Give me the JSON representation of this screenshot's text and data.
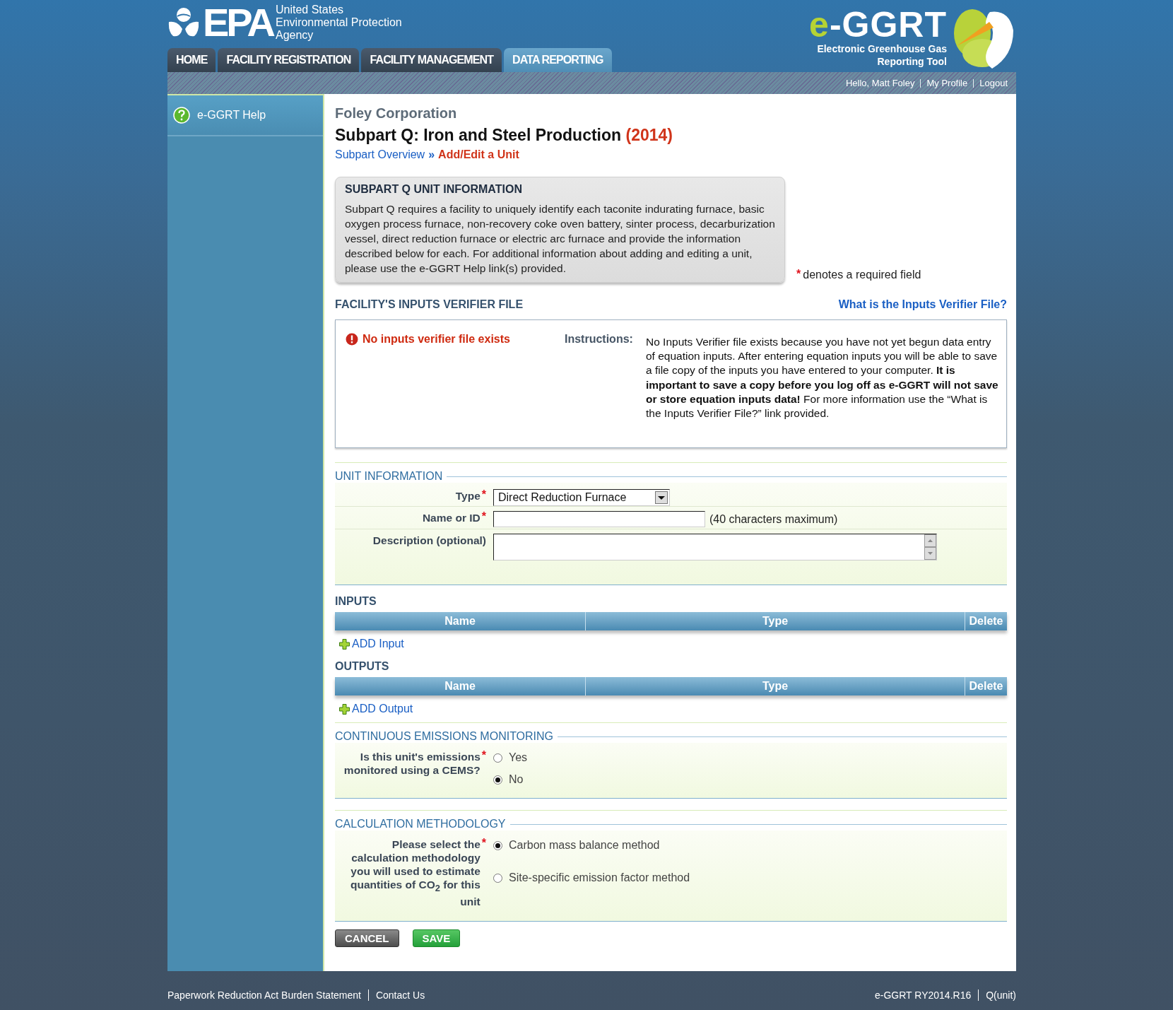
{
  "agency_logo": {
    "mark": "EPA",
    "lines": [
      "United States",
      "Environmental Protection",
      "Agency"
    ]
  },
  "tool_logo": {
    "mark_prefix": "e",
    "mark_rest": "-GGRT",
    "lines": [
      "Electronic Greenhouse Gas",
      "Reporting Tool"
    ]
  },
  "tabs": [
    {
      "label": "HOME",
      "selected": false
    },
    {
      "label": "FACILITY REGISTRATION",
      "selected": false
    },
    {
      "label": "FACILITY MANAGEMENT",
      "selected": false
    },
    {
      "label": "DATA REPORTING",
      "selected": true
    }
  ],
  "user_bar": {
    "greeting": "Hello, Matt Foley",
    "links": [
      "My Profile",
      "Logout"
    ]
  },
  "sidebar": {
    "items": [
      {
        "label": "e-GGRT Help"
      }
    ]
  },
  "required_mark": "*",
  "page": {
    "facility": "Foley Corporation",
    "title": "Subpart Q: Iron and Steel Production",
    "year": "(2014)",
    "breadcrumb_separator": "»",
    "breadcrumb": [
      {
        "label": "Subpart Overview",
        "current": false
      },
      {
        "label": "Add/Edit a Unit",
        "current": true
      }
    ]
  },
  "info_box": {
    "heading": "SUBPART Q UNIT INFORMATION",
    "text": "Subpart Q requires a facility to uniquely identify each taconite indurating furnace, basic oxygen process furnace, non-recovery coke oven battery, sinter process, decarburization vessel, direct reduction furnace or electric arc furnace and provide the information described below for each. For additional information about adding and editing a unit, please use the e-GGRT Help link(s) provided."
  },
  "required_note": "denotes a required field",
  "verifier": {
    "heading": "FACILITY'S INPUTS VERIFIER FILE",
    "help_link": "What is the Inputs Verifier File?",
    "status": "No inputs verifier file exists",
    "instructions_label": "Instructions:",
    "instructions": "No Inputs Verifier file exists because you have not yet begun data entry of equation inputs.  After entering equation inputs you will be able to save a file copy of the inputs you have entered to your computer.  **It is important to save a copy before you log off as e-GGRT will not save or store equation inputs data!** For more information use the “What is the Inputs Verifier File?” link provided."
  },
  "unit_information": {
    "legend": "UNIT INFORMATION",
    "fields": [
      {
        "kind": "select",
        "label": "Type",
        "required": true,
        "value": "Direct Reduction Furnace"
      },
      {
        "kind": "text",
        "label": "Name or ID",
        "required": true,
        "hint": "(40 characters maximum)"
      },
      {
        "kind": "textarea",
        "label": "Description (optional)",
        "required": false
      }
    ]
  },
  "inputs": {
    "heading": "INPUTS",
    "columns": [
      "Name",
      "Type",
      "Delete"
    ],
    "add_link": "ADD Input"
  },
  "outputs": {
    "heading": "OUTPUTS",
    "columns": [
      "Name",
      "Type",
      "Delete"
    ],
    "add_link": "ADD Output"
  },
  "cems": {
    "legend": "CONTINUOUS EMISSIONS MONITORING",
    "question": "Is this unit's emissions monitored using a CEMS?",
    "required": true,
    "options": [
      {
        "label": "Yes",
        "selected": false
      },
      {
        "label": "No",
        "selected": true
      }
    ]
  },
  "calculation": {
    "legend": "CALCULATION METHODOLOGY",
    "question": "Please select the calculation methodology you will used to estimate quantities of CO$_{2}$ for this unit",
    "required": true,
    "options": [
      {
        "label": "Carbon mass balance method",
        "selected": true
      },
      {
        "label": "Site-specific emission factor method",
        "selected": false
      }
    ]
  },
  "buttons": [
    {
      "kind": "cancel",
      "label": "CANCEL"
    },
    {
      "kind": "save",
      "label": "SAVE"
    }
  ],
  "footer": {
    "left": [
      "Paperwork Reduction Act Burden Statement",
      "Contact Us"
    ],
    "right": [
      "e-GGRT RY2014.R16",
      "Q(unit)"
    ]
  }
}
